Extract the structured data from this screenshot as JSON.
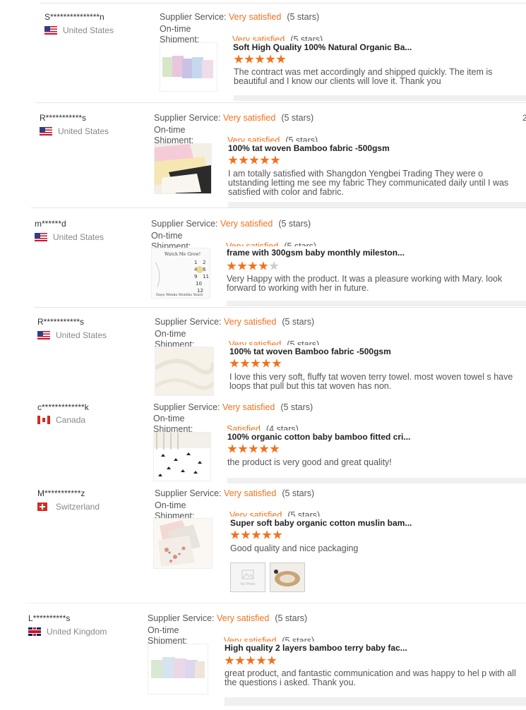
{
  "edge_number": "2",
  "reviews": [
    {
      "author": "S***************n",
      "country": "United States",
      "flag": "us",
      "service_label": "Supplier Service:",
      "service_value": "Very satisfied",
      "service_stars": "(5 stars)",
      "shipment_label": "On-time Shipment:",
      "shipment_value": "Very satisfied",
      "shipment_stars": "(5 stars)",
      "product": "Soft High Quality 100% Natural Organic Ba...",
      "rating": 5,
      "comment": "The contract was met accordingly and shipped quickly. The item is beautiful and I know our clients will love it. Thank you"
    },
    {
      "author": "R***********s",
      "country": "United States",
      "flag": "us",
      "service_label": "Supplier Service:",
      "service_value": "Very satisfied",
      "service_stars": "(5 stars)",
      "shipment_label": "On-time Shipment:",
      "shipment_value": "Very satisfied",
      "shipment_stars": "(5 stars)",
      "product": "100% tat woven Bamboo fabric -500gsm",
      "rating": 5,
      "comment": "I am totally satisfied with Shangdon Yengbei Trading  They were o utstanding letting me see my fabric They communicated daily until I was satisfied with color and fabric."
    },
    {
      "author": "m******d",
      "country": "United States",
      "flag": "us",
      "service_label": "Supplier Service:",
      "service_value": "Very satisfied",
      "service_stars": "(5 stars)",
      "shipment_label": "On-time Shipment:",
      "shipment_value": "Very satisfied",
      "shipment_stars": "(5 stars)",
      "product": "frame with 300gsm baby monthly mileston...",
      "rating": 4,
      "comment": "Very Happy with the product. It was a pleasure working with Mary. look forward to working with her in future."
    },
    {
      "author": "R***********s",
      "country": "United States",
      "flag": "us",
      "service_label": "Supplier Service:",
      "service_value": "Very satisfied",
      "service_stars": "(5 stars)",
      "shipment_label": "On-time Shipment:",
      "shipment_value": "Very satisfied",
      "shipment_stars": "(5 stars)",
      "product": "100% tat woven Bamboo fabric -500gsm",
      "rating": 5,
      "comment": "I love this very soft, fluffy tat woven terry towel. most woven towel s have loops that pull but this tat woven has non."
    },
    {
      "author": "c*************k",
      "country": "Canada",
      "flag": "ca",
      "service_label": "Supplier Service:",
      "service_value": "Very satisfied",
      "service_stars": "(5 stars)",
      "shipment_label": "On-time Shipment:",
      "shipment_value": "Satisfied",
      "shipment_stars": "(4 stars)",
      "product": "100% organic cotton baby bamboo fitted cri...",
      "rating": 5,
      "comment": "the product is very good and great quality!"
    },
    {
      "author": "M***********z",
      "country": "Switzerland",
      "flag": "ch",
      "service_label": "Supplier Service:",
      "service_value": "Very satisfied",
      "service_stars": "(5 stars)",
      "shipment_label": "On-time Shipment:",
      "shipment_value": "Very satisfied",
      "shipment_stars": "(5 stars)",
      "product": "Super soft baby organic cotton muslin bam...",
      "rating": 5,
      "comment": "Good quality and nice packaging",
      "photo_placeholder": "No Photo"
    },
    {
      "author": "L**********s",
      "country": "United Kingdom",
      "flag": "uk",
      "service_label": "Supplier Service:",
      "service_value": "Very satisfied",
      "service_stars": "(5 stars)",
      "shipment_label": "On-time Shipment:",
      "shipment_value": "Very satisfied",
      "shipment_stars": "(5 stars)",
      "product": "High quality 2 layers bamboo terry baby fac...",
      "rating": 5,
      "comment": "great product, and fantastic communication and was happy to hel p with all the questions i asked. Thank you."
    }
  ]
}
